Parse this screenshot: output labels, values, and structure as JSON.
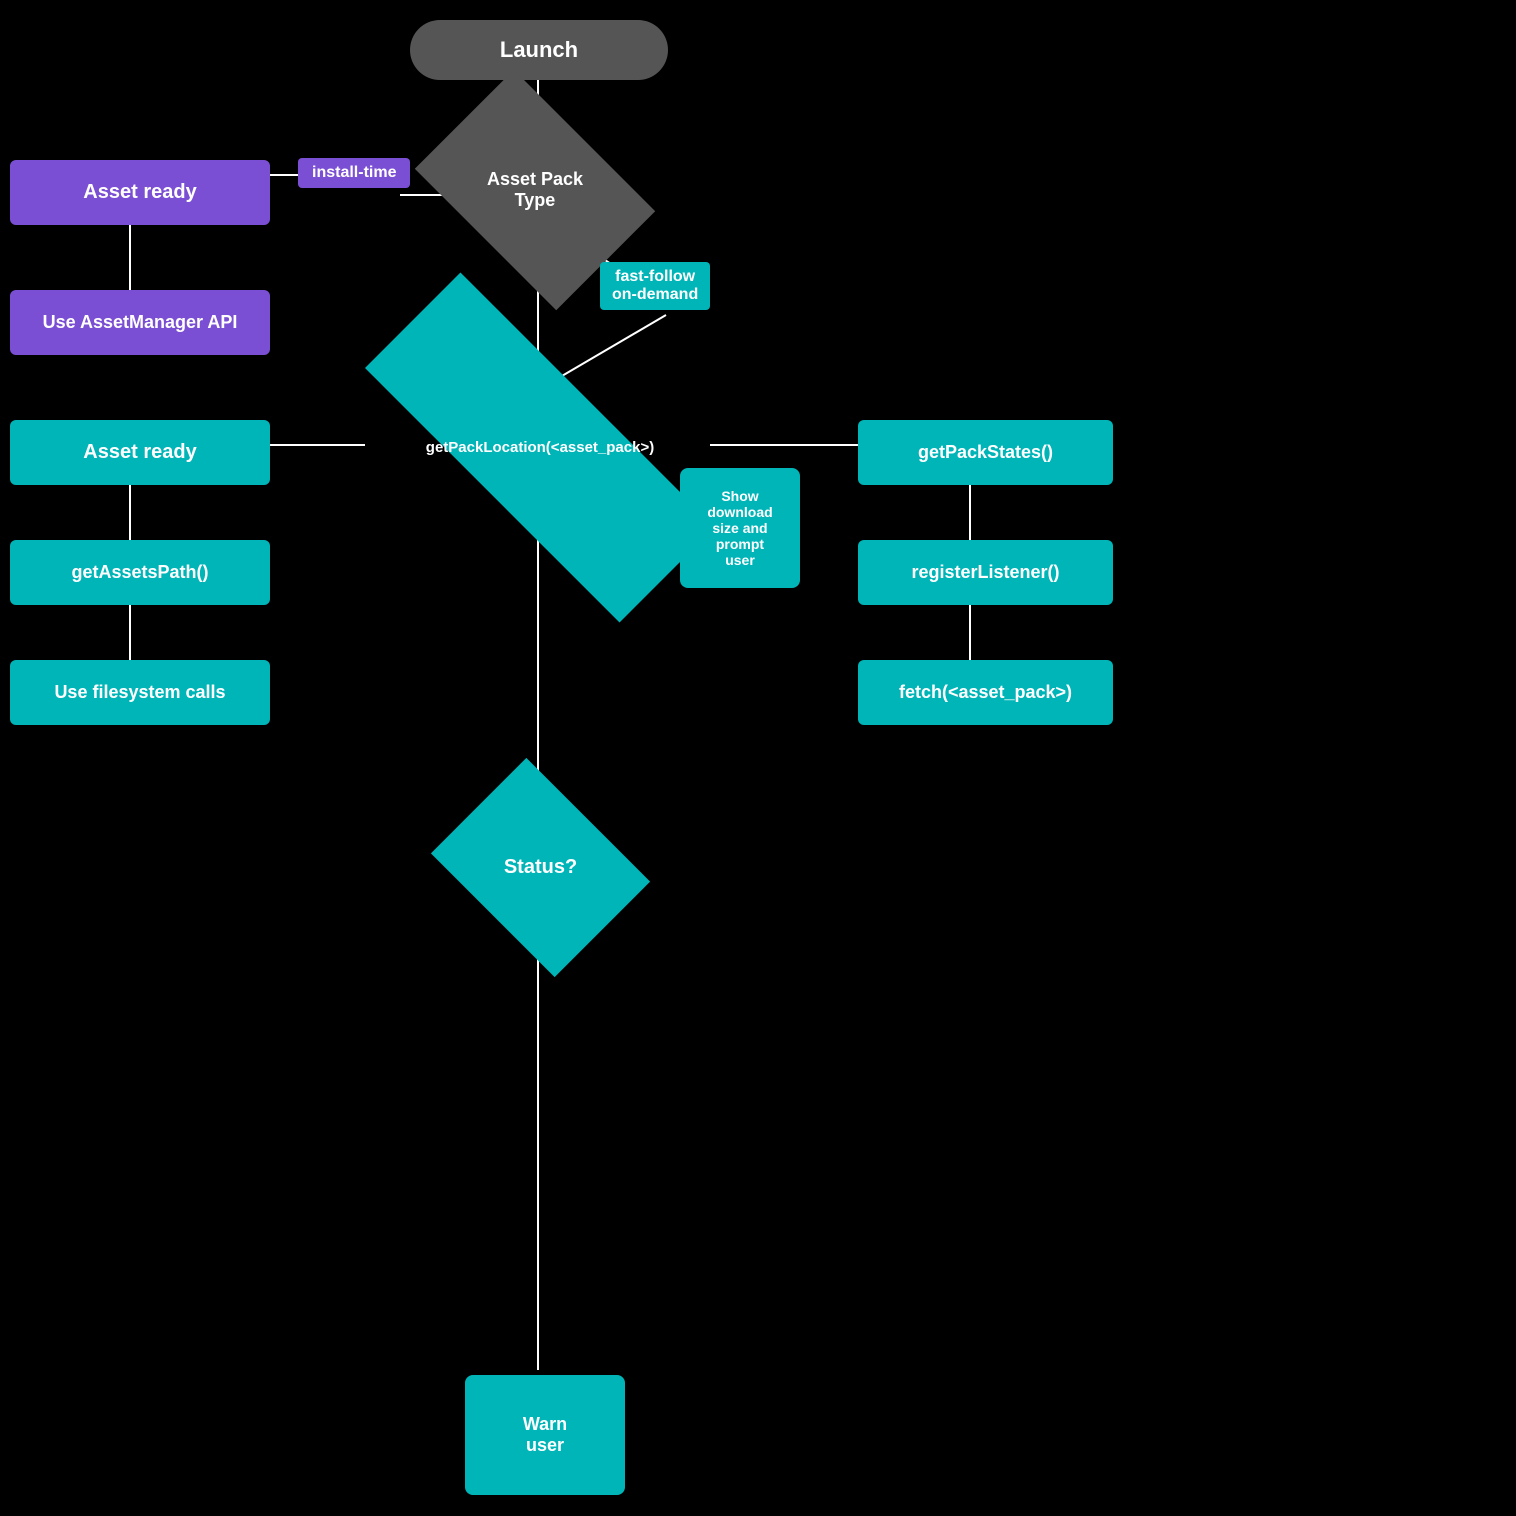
{
  "nodes": {
    "launch": {
      "label": "Launch"
    },
    "assetPackType": {
      "label": "Asset Pack\nType"
    },
    "installTime": {
      "label": "install-time"
    },
    "fastFollow": {
      "label": "fast-follow\non-demand"
    },
    "assetReady1": {
      "label": "Asset ready"
    },
    "useAssetManager": {
      "label": "Use AssetManager API"
    },
    "assetReady2": {
      "label": "Asset ready"
    },
    "getPackLocation": {
      "label": "getPackLocation(<asset_pack>)"
    },
    "getAssetsPath": {
      "label": "getAssetsPath()"
    },
    "useFilesystem": {
      "label": "Use filesystem calls"
    },
    "showDownload": {
      "label": "Show\ndownload\nsize and\nprompt\nuser"
    },
    "getPackStates": {
      "label": "getPackStates()"
    },
    "registerListener": {
      "label": "registerListener()"
    },
    "fetchAssetPack": {
      "label": "fetch(<asset_pack>)"
    },
    "status": {
      "label": "Status?"
    },
    "warnUser": {
      "label": "Warn\nuser"
    }
  }
}
